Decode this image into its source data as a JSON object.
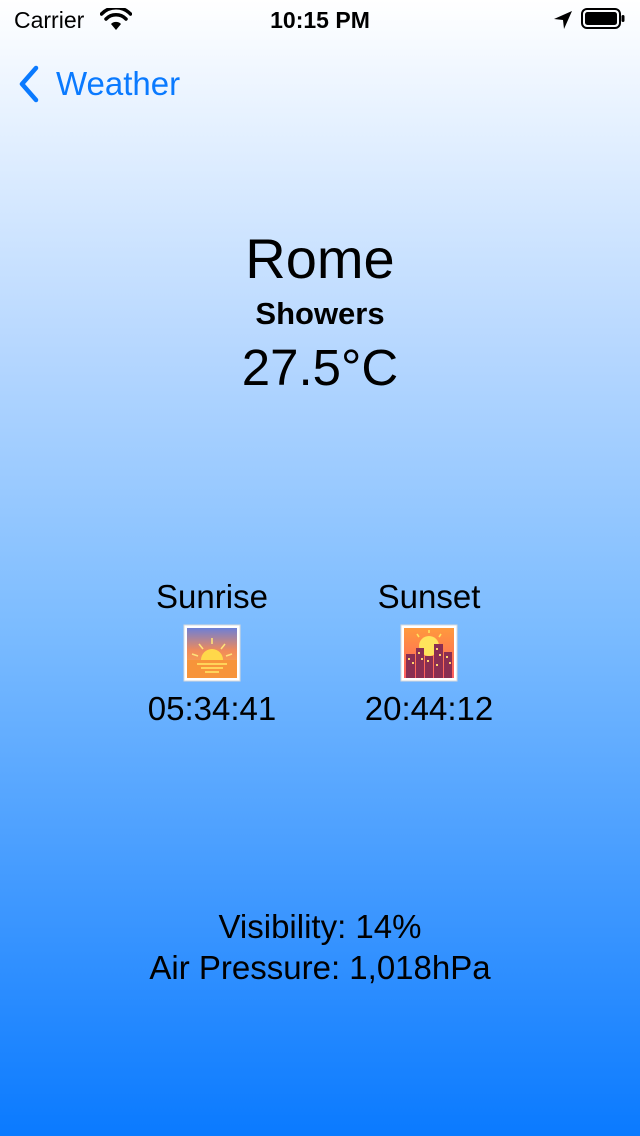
{
  "status_bar": {
    "carrier": "Carrier",
    "time": "10:15 PM",
    "icons": [
      "wifi-icon",
      "location-arrow-icon",
      "battery-icon"
    ]
  },
  "nav": {
    "back_label": "Weather",
    "accent": "#0a7aff"
  },
  "weather": {
    "city": "Rome",
    "condition": "Showers",
    "temperature": "27.5°C"
  },
  "sun": {
    "sunrise": {
      "title": "Sunrise",
      "time": "05:34:41",
      "icon": "sunrise-icon"
    },
    "sunset": {
      "title": "Sunset",
      "time": "20:44:12",
      "icon": "sunset-city-icon"
    }
  },
  "details": {
    "visibility": "Visibility: 14%",
    "air_pressure": "Air Pressure: 1,018hPa"
  }
}
